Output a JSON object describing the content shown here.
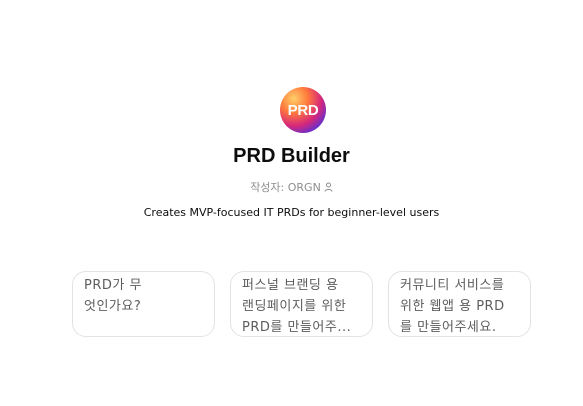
{
  "gpt": {
    "logo_text": "PRD",
    "title": "PRD Builder",
    "author_label": "작성자: ORGN",
    "description": "Creates MVP-focused IT PRDs for beginner-level users"
  },
  "starters": [
    {
      "text": "PRD가 무\n엇인가요?"
    },
    {
      "text": "퍼스널 브랜딩 용\n랜딩페이지를 위한\nPRD를 만들어주..."
    },
    {
      "text": "커뮤니티 서비스를\n위한 웹앱 용 PRD\n를 만들어주세요."
    }
  ],
  "icons": {
    "author": "person-icon"
  },
  "colors": {
    "title": "#0d0d0d",
    "muted": "#8e8e8e",
    "card_border": "#e3e3e3",
    "card_text": "#5d5d5d"
  }
}
